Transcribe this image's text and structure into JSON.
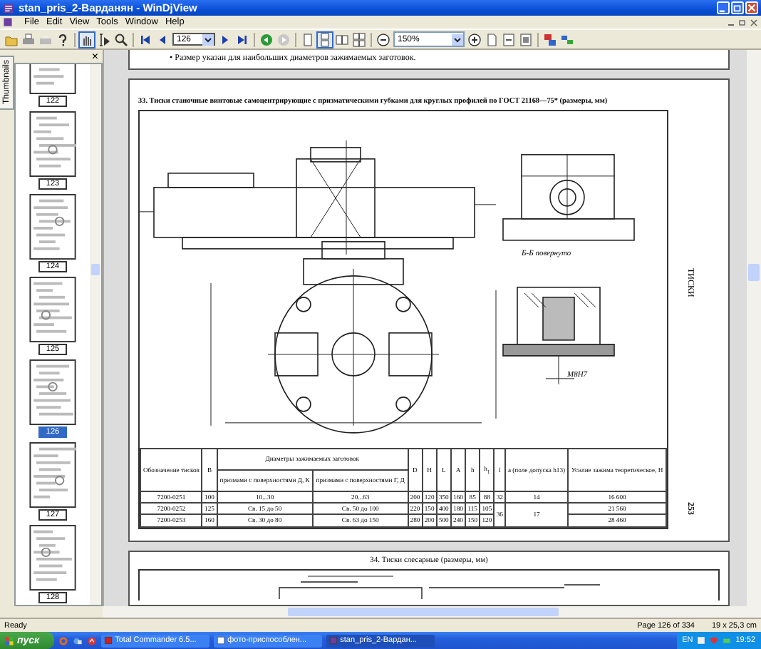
{
  "window": {
    "title": "stan_pris_2-Варданян - WinDjView"
  },
  "menu": [
    "File",
    "Edit",
    "View",
    "Tools",
    "Window",
    "Help"
  ],
  "toolbar": {
    "page": "126",
    "zoom": "150%"
  },
  "sidebar": {
    "tab": "Thumbnails",
    "close": "×",
    "thumbnails": [
      {
        "label": "122",
        "selected": false
      },
      {
        "label": "123",
        "selected": false
      },
      {
        "label": "124",
        "selected": false
      },
      {
        "label": "125",
        "selected": false
      },
      {
        "label": "126",
        "selected": true
      },
      {
        "label": "127",
        "selected": false
      },
      {
        "label": "128",
        "selected": false
      }
    ]
  },
  "document": {
    "previous_page_note": "• Размер указан для наибольших диаметров зажимаемых заготовок.",
    "heading": "33. Тиски станочные винтовые самоцентрирующие с призматическими губками для круглых профилей по ГОСТ 21168—75* (размеры, мм)",
    "drawing_labels": [
      "Б-Б повернуто",
      "М8Н7"
    ],
    "table": {
      "columns": [
        {
          "text": "Обозначение тисков"
        },
        {
          "text": "B"
        },
        {
          "text": "Диаметры зажимаемых заготовок",
          "colspan": 2,
          "children": [
            {
              "text": "призмами с поверхностями Д, К"
            },
            {
              "text": "призмами с поверхностями Г, Д"
            }
          ]
        },
        {
          "text": "D"
        },
        {
          "text": "H"
        },
        {
          "text": "L"
        },
        {
          "text": "A"
        },
        {
          "text": "h"
        },
        {
          "text": "h$_{1}$"
        },
        {
          "text": "l"
        },
        {
          "text": "a (поле допуска h13)"
        },
        {
          "text": "Усилие зажима теоретическое, Н"
        }
      ],
      "rows": [
        {
          "cells": [
            {
              "text": "7200-0251"
            },
            {
              "text": "100"
            },
            {
              "text": "10...30"
            },
            {
              "text": "20...63"
            },
            {
              "text": "200"
            },
            {
              "text": "120"
            },
            {
              "text": "350"
            },
            {
              "text": "160"
            },
            {
              "text": "85"
            },
            {
              "text": "88"
            },
            {
              "text": "32"
            },
            {
              "text": "14"
            },
            {
              "text": "16 600"
            }
          ]
        },
        {
          "cells": [
            {
              "text": "7200-0252"
            },
            {
              "text": "125"
            },
            {
              "text": "Св. 15 до 50"
            },
            {
              "text": "Св. 50 до 100"
            },
            {
              "text": "220"
            },
            {
              "text": "150"
            },
            {
              "text": "400"
            },
            {
              "text": "180"
            },
            {
              "text": "115"
            },
            {
              "text": "105"
            },
            {
              "text": "36",
              "rowspan": 2
            },
            {
              "text": "17",
              "rowspan": 2
            },
            {
              "text": "21 560"
            }
          ]
        },
        {
          "cells": [
            {
              "text": "7200-0253"
            },
            {
              "text": "160"
            },
            {
              "text": "Св. 30 до 80"
            },
            {
              "text": "Св. 63 до 150"
            },
            {
              "text": "280"
            },
            {
              "text": "200"
            },
            {
              "text": "500"
            },
            {
              "text": "240"
            },
            {
              "text": "150"
            },
            {
              "text": "120"
            },
            {
              "text": "28 460"
            }
          ]
        }
      ]
    },
    "margin_title": "ТИСКИ",
    "page_number": "253",
    "next_heading": "34. Тиски слесарные (размеры, мм)"
  },
  "status_bar": {
    "text": "Ready",
    "page": "Page 126 of 334",
    "size": "19 x 25,3 cm"
  },
  "taskbar": {
    "start": "пуск",
    "tasks": [
      {
        "label": "Total Commander 6.5...",
        "selected": false
      },
      {
        "label": "фото-приспособлен...",
        "selected": false
      },
      {
        "label": "stan_pris_2-Вардан...",
        "selected": true
      }
    ],
    "language": "EN",
    "clock": "19:52"
  }
}
